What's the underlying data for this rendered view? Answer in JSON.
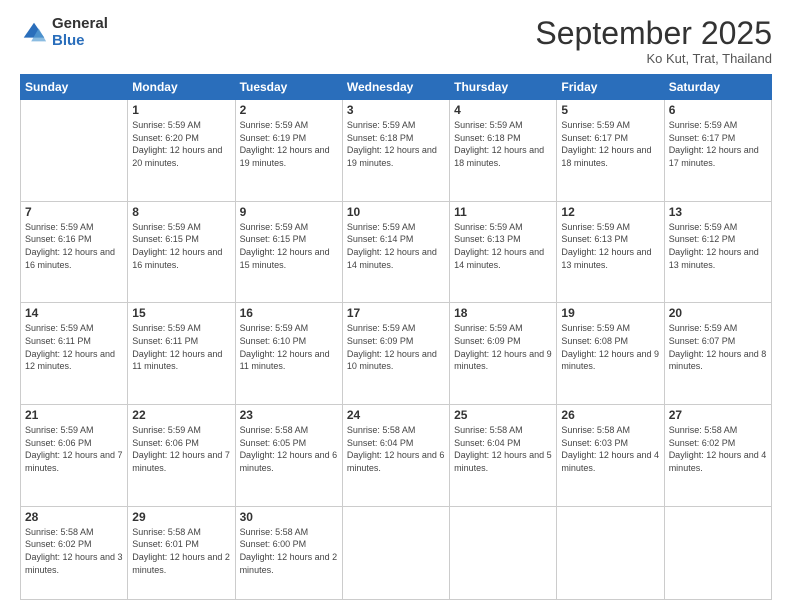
{
  "logo": {
    "general": "General",
    "blue": "Blue"
  },
  "header": {
    "month": "September 2025",
    "location": "Ko Kut, Trat, Thailand"
  },
  "weekdays": [
    "Sunday",
    "Monday",
    "Tuesday",
    "Wednesday",
    "Thursday",
    "Friday",
    "Saturday"
  ],
  "weeks": [
    [
      {
        "day": "",
        "info": ""
      },
      {
        "day": "1",
        "info": "Sunrise: 5:59 AM\nSunset: 6:20 PM\nDaylight: 12 hours\nand 20 minutes."
      },
      {
        "day": "2",
        "info": "Sunrise: 5:59 AM\nSunset: 6:19 PM\nDaylight: 12 hours\nand 19 minutes."
      },
      {
        "day": "3",
        "info": "Sunrise: 5:59 AM\nSunset: 6:18 PM\nDaylight: 12 hours\nand 19 minutes."
      },
      {
        "day": "4",
        "info": "Sunrise: 5:59 AM\nSunset: 6:18 PM\nDaylight: 12 hours\nand 18 minutes."
      },
      {
        "day": "5",
        "info": "Sunrise: 5:59 AM\nSunset: 6:17 PM\nDaylight: 12 hours\nand 18 minutes."
      },
      {
        "day": "6",
        "info": "Sunrise: 5:59 AM\nSunset: 6:17 PM\nDaylight: 12 hours\nand 17 minutes."
      }
    ],
    [
      {
        "day": "7",
        "info": ""
      },
      {
        "day": "8",
        "info": "Sunrise: 5:59 AM\nSunset: 6:15 PM\nDaylight: 12 hours\nand 16 minutes."
      },
      {
        "day": "9",
        "info": "Sunrise: 5:59 AM\nSunset: 6:15 PM\nDaylight: 12 hours\nand 15 minutes."
      },
      {
        "day": "10",
        "info": "Sunrise: 5:59 AM\nSunset: 6:14 PM\nDaylight: 12 hours\nand 14 minutes."
      },
      {
        "day": "11",
        "info": "Sunrise: 5:59 AM\nSunset: 6:13 PM\nDaylight: 12 hours\nand 14 minutes."
      },
      {
        "day": "12",
        "info": "Sunrise: 5:59 AM\nSunset: 6:13 PM\nDaylight: 12 hours\nand 13 minutes."
      },
      {
        "day": "13",
        "info": "Sunrise: 5:59 AM\nSunset: 6:12 PM\nDaylight: 12 hours\nand 13 minutes."
      }
    ],
    [
      {
        "day": "14",
        "info": ""
      },
      {
        "day": "15",
        "info": "Sunrise: 5:59 AM\nSunset: 6:11 PM\nDaylight: 12 hours\nand 11 minutes."
      },
      {
        "day": "16",
        "info": "Sunrise: 5:59 AM\nSunset: 6:10 PM\nDaylight: 12 hours\nand 11 minutes."
      },
      {
        "day": "17",
        "info": "Sunrise: 5:59 AM\nSunset: 6:09 PM\nDaylight: 12 hours\nand 10 minutes."
      },
      {
        "day": "18",
        "info": "Sunrise: 5:59 AM\nSunset: 6:09 PM\nDaylight: 12 hours\nand 9 minutes."
      },
      {
        "day": "19",
        "info": "Sunrise: 5:59 AM\nSunset: 6:08 PM\nDaylight: 12 hours\nand 9 minutes."
      },
      {
        "day": "20",
        "info": "Sunrise: 5:59 AM\nSunset: 6:07 PM\nDaylight: 12 hours\nand 8 minutes."
      }
    ],
    [
      {
        "day": "21",
        "info": ""
      },
      {
        "day": "22",
        "info": "Sunrise: 5:59 AM\nSunset: 6:06 PM\nDaylight: 12 hours\nand 7 minutes."
      },
      {
        "day": "23",
        "info": "Sunrise: 5:58 AM\nSunset: 6:05 PM\nDaylight: 12 hours\nand 6 minutes."
      },
      {
        "day": "24",
        "info": "Sunrise: 5:58 AM\nSunset: 6:04 PM\nDaylight: 12 hours\nand 6 minutes."
      },
      {
        "day": "25",
        "info": "Sunrise: 5:58 AM\nSunset: 6:04 PM\nDaylight: 12 hours\nand 5 minutes."
      },
      {
        "day": "26",
        "info": "Sunrise: 5:58 AM\nSunset: 6:03 PM\nDaylight: 12 hours\nand 4 minutes."
      },
      {
        "day": "27",
        "info": "Sunrise: 5:58 AM\nSunset: 6:02 PM\nDaylight: 12 hours\nand 4 minutes."
      }
    ],
    [
      {
        "day": "28",
        "info": "Sunrise: 5:58 AM\nSunset: 6:02 PM\nDaylight: 12 hours\nand 3 minutes."
      },
      {
        "day": "29",
        "info": "Sunrise: 5:58 AM\nSunset: 6:01 PM\nDaylight: 12 hours\nand 2 minutes."
      },
      {
        "day": "30",
        "info": "Sunrise: 5:58 AM\nSunset: 6:00 PM\nDaylight: 12 hours\nand 2 minutes."
      },
      {
        "day": "",
        "info": ""
      },
      {
        "day": "",
        "info": ""
      },
      {
        "day": "",
        "info": ""
      },
      {
        "day": "",
        "info": ""
      }
    ]
  ],
  "week1_day7_info": "Sunrise: 5:59 AM\nSunset: 6:16 PM\nDaylight: 12 hours\nand 16 minutes.",
  "week3_day14_info": "Sunrise: 5:59 AM\nSunset: 6:11 PM\nDaylight: 12 hours\nand 12 minutes.",
  "week4_day21_info": "Sunrise: 5:59 AM\nSunset: 6:06 PM\nDaylight: 12 hours\nand 7 minutes."
}
